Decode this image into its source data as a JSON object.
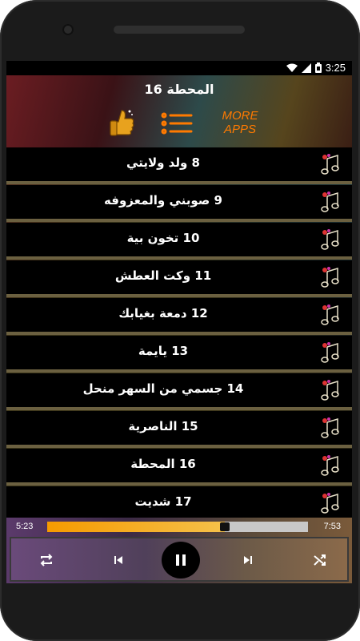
{
  "status_bar": {
    "time": "3:25"
  },
  "header": {
    "title": "16 المحطة",
    "more_apps_line1": "MORE",
    "more_apps_line2": "APPS"
  },
  "playlist": {
    "items": [
      {
        "label": "8 ولد ولايتي"
      },
      {
        "label": "9 صوبني والمعزوفه"
      },
      {
        "label": "10  تخون بية"
      },
      {
        "label": "11 وكت العطش"
      },
      {
        "label": "12 دمعة بغيابك"
      },
      {
        "label": "13  يايمة"
      },
      {
        "label": "14 جسمي من السهر منحل"
      },
      {
        "label": "15 الناصرية"
      },
      {
        "label": "16 المحطة"
      },
      {
        "label": "17 شديت"
      }
    ]
  },
  "player": {
    "elapsed": "5:23",
    "duration": "7:53",
    "progress": 0.68
  },
  "colors": {
    "accent": "#ff7a00",
    "seek_fill": "#f59a00",
    "divider": "#6b6040"
  }
}
